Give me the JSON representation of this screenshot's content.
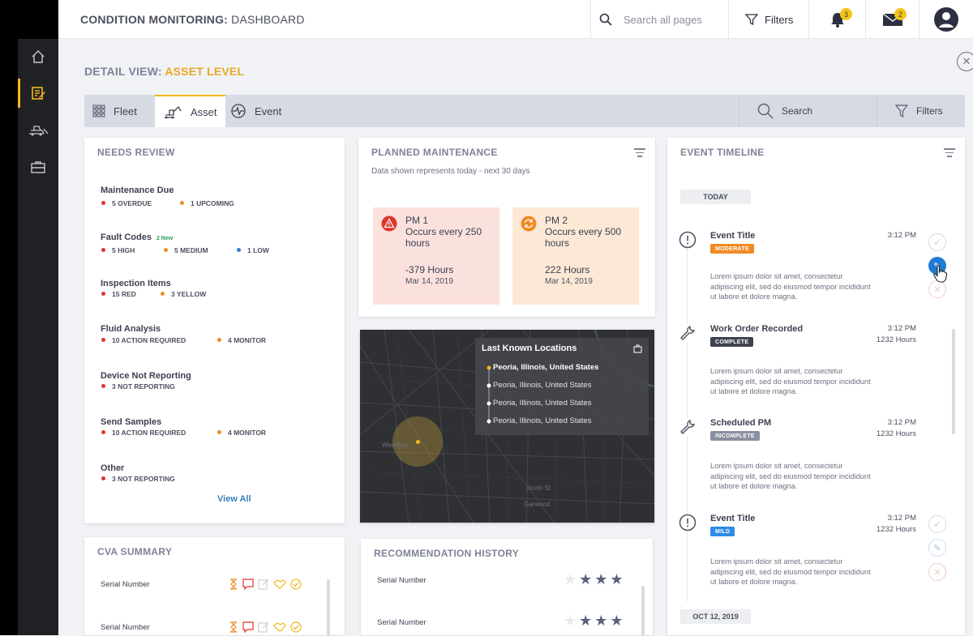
{
  "header": {
    "title_bold": "CONDITION MONITORING:",
    "title_rest": "DASHBOARD",
    "search_placeholder": "Search all pages",
    "filters_label": "Filters",
    "notifications_count": "3",
    "messages_count": "2"
  },
  "detail": {
    "prefix": "DETAIL VIEW:",
    "level": "ASSET LEVEL"
  },
  "tabs": {
    "fleet": "Fleet",
    "asset": "Asset",
    "event": "Event",
    "search": "Search",
    "filters": "Filters",
    "active": "Asset"
  },
  "needs_review": {
    "title": "NEEDS REVIEW",
    "items": [
      {
        "name": "Maintenance Due",
        "new": "",
        "stats": [
          {
            "label": "5 OVERDUE",
            "color": "#e0352b"
          },
          {
            "label": "1 UPCOMING",
            "color": "#f08a24"
          }
        ]
      },
      {
        "name": "Fault Codes",
        "new": "2 New",
        "stats": [
          {
            "label": "5 HIGH",
            "color": "#e0352b"
          },
          {
            "label": "5 MEDIUM",
            "color": "#f08a24"
          },
          {
            "label": "1 LOW",
            "color": "#2f7fd1"
          }
        ]
      },
      {
        "name": "Inspection Items",
        "new": "",
        "stats": [
          {
            "label": "15 RED",
            "color": "#e0352b"
          },
          {
            "label": "3 YELLOW",
            "color": "#f08a24"
          }
        ]
      },
      {
        "name": "Fluid Analysis",
        "new": "",
        "stats": [
          {
            "label": "10 ACTION REQUIRED",
            "color": "#e0352b"
          },
          {
            "label": "4 MONITOR",
            "color": "#f08a24"
          }
        ]
      },
      {
        "name": "Device Not Reporting",
        "new": "",
        "stats": [
          {
            "label": "3 NOT REPORTING",
            "color": "#e0352b"
          }
        ]
      },
      {
        "name": "Send Samples",
        "new": "",
        "stats": [
          {
            "label": "10 ACTION REQUIRED",
            "color": "#e0352b"
          },
          {
            "label": "4 MONITOR",
            "color": "#f08a24"
          }
        ]
      },
      {
        "name": "Other",
        "new": "",
        "stats": [
          {
            "label": "3 NOT REPORTING",
            "color": "#e0352b"
          }
        ]
      }
    ],
    "view_all": "View All"
  },
  "planned_maintenance": {
    "title": "PLANNED MAINTENANCE",
    "subtitle": "Data shown represents today - next 30 days",
    "items": [
      {
        "name": "PM 1",
        "desc": "Occurs every 250 hours",
        "hours": "-379 Hours",
        "date": "Mar 14, 2019",
        "bg": "#fbe1de",
        "icon": "warning-icon"
      },
      {
        "name": "PM 2",
        "desc": "Occurs every 500 hours",
        "hours": "222 Hours",
        "date": "Mar 14, 2019",
        "bg": "#fde8d6",
        "icon": "refresh-icon"
      }
    ]
  },
  "map": {
    "panel_title": "Last Known Locations",
    "locations": [
      "Peoria, Illinois, United States",
      "Peoria, Illinois, United States",
      "Peoria, Illinois, United States",
      "Peoria, Illinois, United States"
    ],
    "labels": [
      "Westfield",
      "Garwood",
      "North St"
    ]
  },
  "event_timeline": {
    "title": "EVENT TIMELINE",
    "today_label": "TODAY",
    "date_label": "OCT 12, 2019",
    "events": [
      {
        "icon": "alert-circle-icon",
        "title": "Event Title",
        "badge": "MODERATE",
        "badge_color": "#f08a24",
        "time": "3:12 PM",
        "hours": "",
        "desc": "Lorem ipsum dolor sit amet, consectetur adipiscing elit, sed do eiusmod tempor incididunt ut labore et dolore magna."
      },
      {
        "icon": "wrench-icon",
        "title": "Work Order Recorded",
        "badge": "COMPLETE",
        "badge_color": "#3d4150",
        "time": "3:12 PM",
        "hours": "1232 Hours",
        "desc": "Lorem ipsum dolor sit amet, consectetur adipiscing elit, sed do eiusmod tempor incididunt ut labore et dolore magna."
      },
      {
        "icon": "wrench-icon",
        "title": "Scheduled PM",
        "badge": "INCOMPLETE",
        "badge_color": "#8a8fa0",
        "time": "3:12 PM",
        "hours": "1232 Hours",
        "desc": "Lorem ipsum dolor sit amet, consectetur adipiscing elit, sed do eiusmod tempor incididunt ut labore et dolore magna."
      },
      {
        "icon": "alert-circle-icon",
        "title": "Event Title",
        "badge": "MILD",
        "badge_color": "#2f8be6",
        "time": "3:12 PM",
        "hours": "1232 Hours",
        "desc": "Lorem ipsum dolor sit amet, consectetur adipiscing elit, sed do eiusmod tempor incididunt ut labore et dolore magna."
      }
    ]
  },
  "cva_summary": {
    "title": "CVA SUMMARY",
    "rows": [
      {
        "label": "Serial Number"
      },
      {
        "label": "Serial Number"
      }
    ]
  },
  "recommendation_history": {
    "title": "RECOMMENDATION HISTORY",
    "rows": [
      {
        "label": "Serial Number",
        "rating": 3
      },
      {
        "label": "Serial Number",
        "rating": 3
      }
    ]
  }
}
